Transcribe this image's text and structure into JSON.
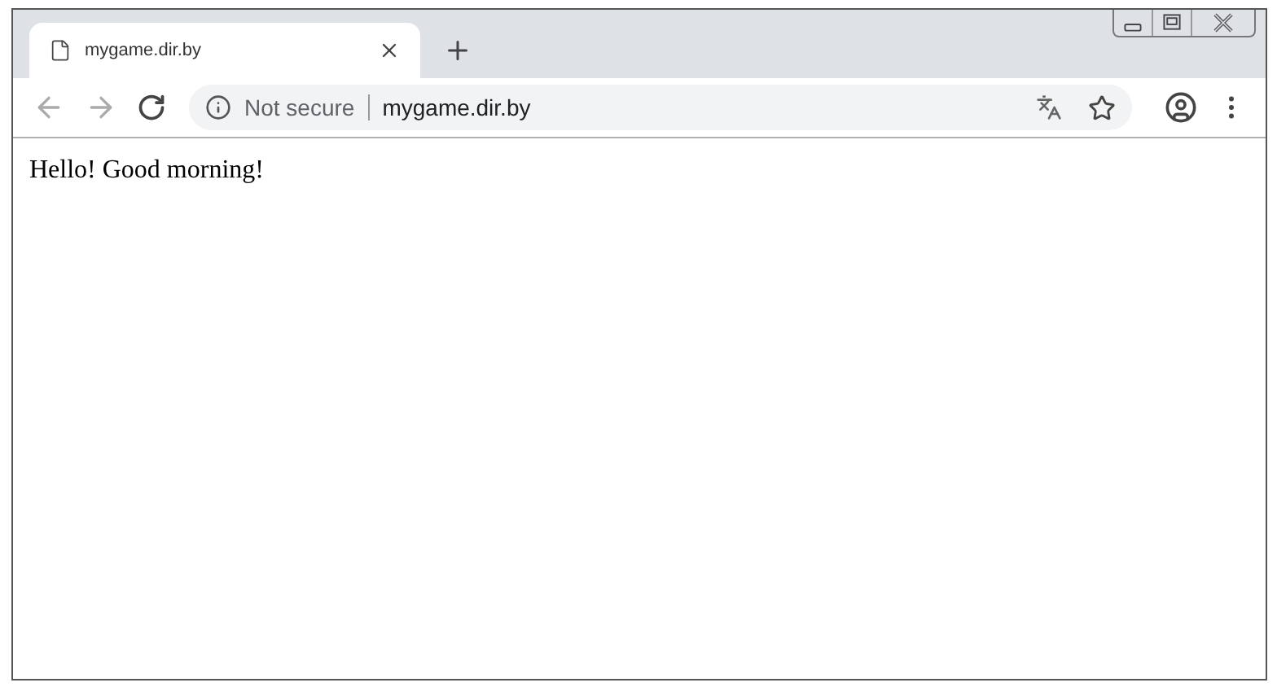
{
  "tabs": [
    {
      "title": "mygame.dir.by",
      "selected": true
    }
  ],
  "address_bar": {
    "security_label": "Not secure",
    "url": "mygame.dir.by"
  },
  "page": {
    "text": "Hello! Good morning!"
  }
}
